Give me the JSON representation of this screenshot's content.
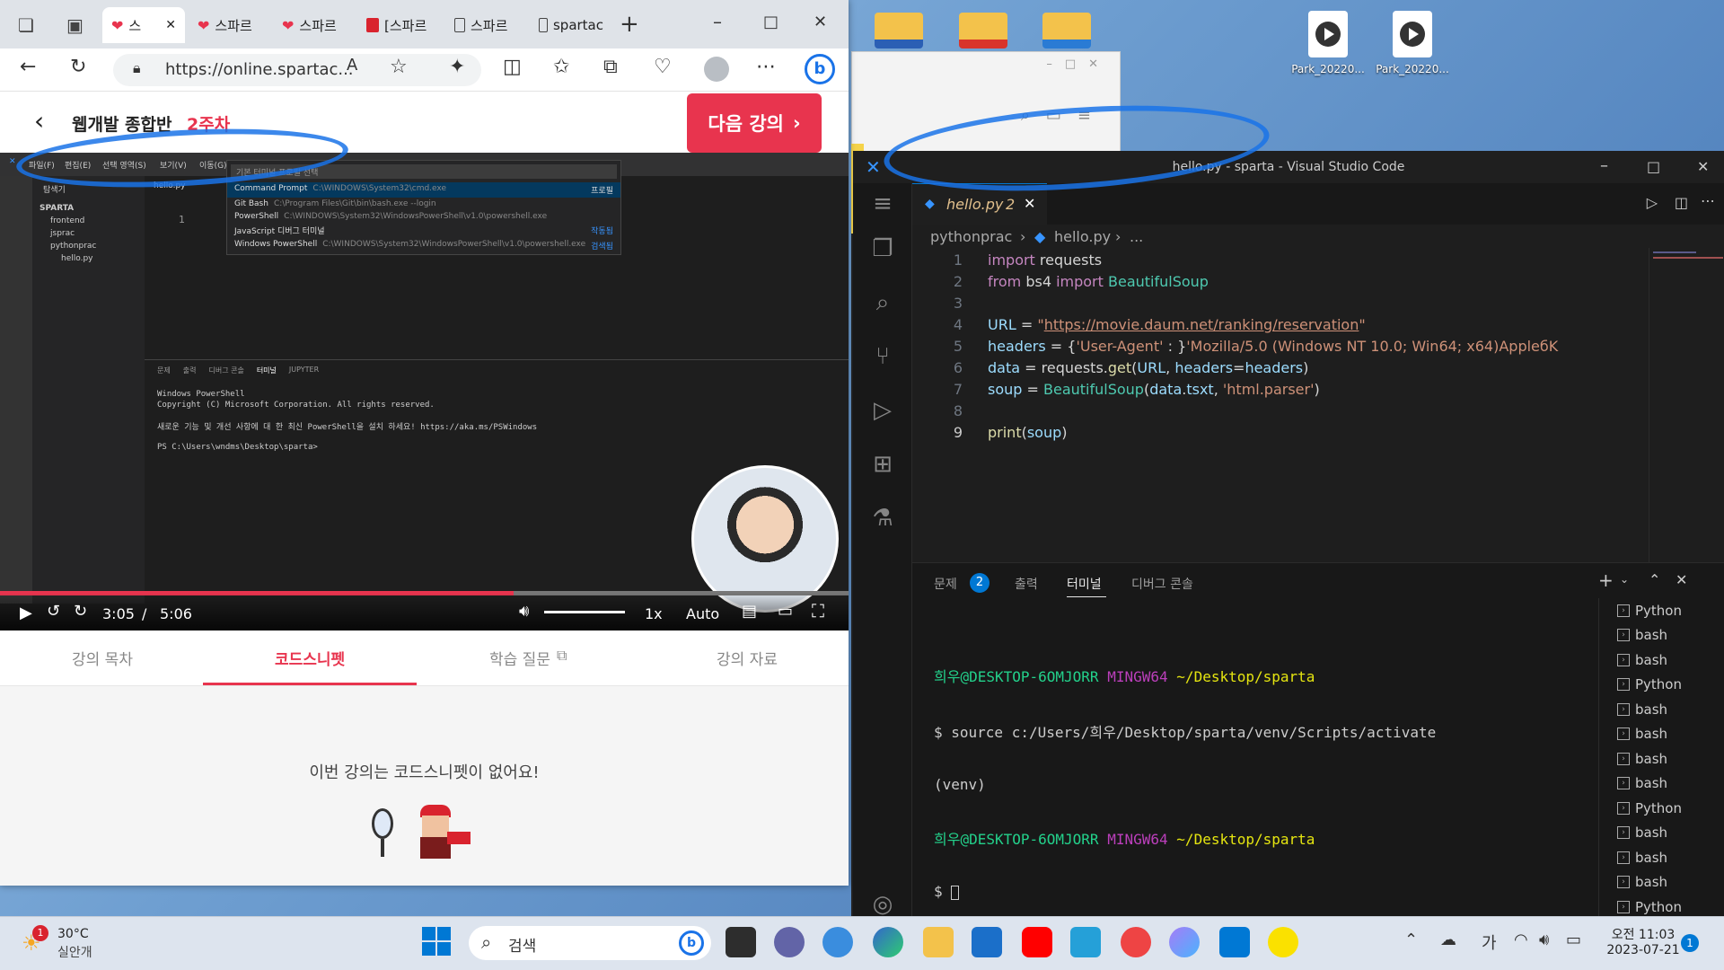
{
  "desktop": {
    "icons": [
      {
        "label": "",
        "type": "folder-word"
      },
      {
        "label": "",
        "type": "folder-hwp"
      },
      {
        "label": "",
        "type": "folder"
      },
      {
        "label": "Park_20220...",
        "type": "media"
      },
      {
        "label": "Park_20220...",
        "type": "media"
      }
    ]
  },
  "edge": {
    "tabs": [
      {
        "label": "스",
        "icon": "heart",
        "active": true
      },
      {
        "label": "스파르",
        "icon": "heart"
      },
      {
        "label": "스파르",
        "icon": "heart"
      },
      {
        "label": "[스파르",
        "icon": "red"
      },
      {
        "label": "스파르",
        "icon": "doc"
      },
      {
        "label": "spartac",
        "icon": "doc"
      }
    ],
    "url": "https://online.spartac...",
    "lecture": {
      "title": "웹개발 종합반",
      "week": "2주차",
      "next_button": "다음 강의"
    },
    "video": {
      "current_time": "3:05",
      "separator": "/",
      "duration": "5:06",
      "speed": "1x",
      "quality": "Auto",
      "progress": 0.605,
      "inner": {
        "menu": [
          "파일(F)",
          "편집(E)",
          "선택 영역(S)",
          "보기(V)",
          "이동(G)"
        ],
        "palette_placeholder": "기본 터미널 프로필 선택",
        "palette_items": [
          {
            "name": "Command Prompt",
            "path": "C:\\WINDOWS\\System32\\cmd.exe",
            "tag": "프로필"
          },
          {
            "name": "Git Bash",
            "path": "C:\\Program Files\\Git\\bin\\bash.exe --login",
            "tag": ""
          },
          {
            "name": "PowerShell",
            "path": "C:\\WINDOWS\\System32\\WindowsPowerShell\\v1.0\\powershell.exe",
            "tag": ""
          },
          {
            "name": "JavaScript 디버그 터미널",
            "path": "",
            "tag": "작동됨"
          },
          {
            "name": "Windows PowerShell",
            "path": "C:\\WINDOWS\\System32\\WindowsPowerShell\\v1.0\\powershell.exe",
            "tag": "검색됨"
          }
        ],
        "explorer_title": "탐색기",
        "tree": [
          "SPARTA",
          "frontend",
          "jsprac",
          "pythonprac",
          "hello.py"
        ],
        "tab": "hello.py",
        "panel_tabs": [
          "문제",
          "출력",
          "디버그 콘솔",
          "터미널",
          "JUPYTER"
        ],
        "terminal": [
          "Windows PowerShell",
          "Copyright (C) Microsoft Corporation. All rights reserved.",
          "새로운 기능 및 개선 사항에 대 한 최신 PowerShell을 설치 하세요! https://aka.ms/PSWindows",
          "PS C:\\Users\\wndms\\Desktop\\sparta>"
        ]
      }
    },
    "lecture_tabs": [
      "강의 목차",
      "코드스니펫",
      "학습 질문",
      "강의 자료"
    ],
    "empty_message": "이번 강의는 코드스니펫이 없어요!"
  },
  "vscode": {
    "title": "hello.py - sparta - Visual Studio Code",
    "tab": {
      "name": "hello.py",
      "badge": "2"
    },
    "breadcrumb": [
      "pythonprac",
      "hello.py",
      "..."
    ],
    "line_numbers": [
      "1",
      "2",
      "3",
      "4",
      "5",
      "6",
      "7",
      "8",
      "9"
    ],
    "panel_tabs": [
      "문제",
      "출력",
      "터미널",
      "디버그 콘솔"
    ],
    "problems_count": "2",
    "terminal_lines": {
      "prompt_user": "희우@DESKTOP-6OMJORR",
      "prompt_env": "MINGW64",
      "prompt_path": "~/Desktop/sparta",
      "cmd1": "$ source c:/Users/희우/Desktop/sparta/venv/Scripts/activate",
      "venv": "(venv)",
      "cmd2": "$ "
    },
    "terminal_list": [
      "Python",
      "bash",
      "bash",
      "Python",
      "bash",
      "bash",
      "bash",
      "bash",
      "Python",
      "bash",
      "bash",
      "bash",
      "Python"
    ]
  },
  "taskbar": {
    "weather_temp": "30°C",
    "weather_desc": "실안개",
    "weather_badge": "1",
    "search_label": "검색",
    "ime": "가",
    "time": "오전 11:03",
    "date": "2023-07-21",
    "notif_count": "1"
  },
  "colors": {
    "accent": "#e8344e",
    "vscode_blue": "#0078d4",
    "annotation": "#1a73e8"
  }
}
